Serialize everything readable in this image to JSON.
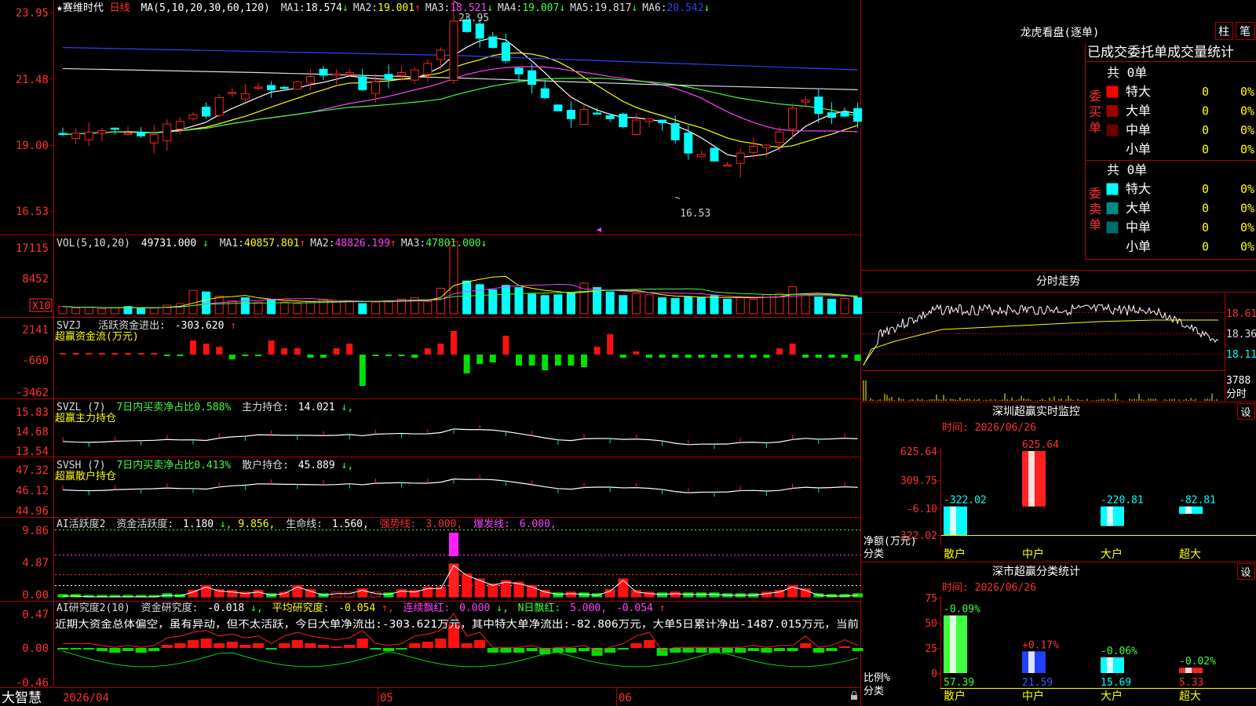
{
  "footer": {
    "app_name": "大智慧",
    "dates": [
      "2026/04",
      "05",
      "06"
    ]
  },
  "main": {
    "stock_name": "★赛维时代",
    "period": "日线",
    "ma_title": "MA(5,10,20,30,60,120)",
    "ma_values": [
      {
        "label": "MA1:",
        "value": "18.574",
        "arrow": "↓",
        "color": "#ffffff"
      },
      {
        "label": "MA2:",
        "value": "19.001",
        "arrow": "↑",
        "color": "#ffff00"
      },
      {
        "label": "MA3:",
        "value": "18.521",
        "arrow": "↓",
        "color": "#ff40ff"
      },
      {
        "label": "MA4:",
        "value": "19.007",
        "arrow": "↓",
        "color": "#40ff40"
      },
      {
        "label": "MA5:",
        "value": "19.817",
        "arrow": "↓",
        "color": "#dddddd"
      },
      {
        "label": "MA6:",
        "value": "20.542",
        "arrow": "↓",
        "color": "#3040ff"
      }
    ],
    "y_ticks": [
      "23.95",
      "21.48",
      "19.00",
      "16.53"
    ],
    "max_label": "23.95",
    "min_label": "16.53",
    "scale_min": 15.2,
    "scale_max": 24.0
  },
  "vol": {
    "title": "VOL(5,10,20)",
    "value": "49731.000",
    "value_arrow": "↓",
    "ma": [
      {
        "label": "MA1:",
        "value": "40857.801",
        "arrow": "↑",
        "color": "#ffff00"
      },
      {
        "label": "MA2:",
        "value": "48826.199",
        "arrow": "↑",
        "color": "#ff40ff"
      },
      {
        "label": "MA3:",
        "value": "47801.000",
        "arrow": "↓",
        "color": "#40ff40"
      }
    ],
    "y_ticks": [
      "17115",
      "8452"
    ],
    "unit": "X10"
  },
  "svzj": {
    "title": "SVZJ",
    "label": "活跃资金进出:",
    "value": "-303.620",
    "arrow": "↑",
    "subtitle": "超赢资金流(万元)",
    "y_ticks": [
      "2141",
      "-660",
      "-3462"
    ]
  },
  "svzl": {
    "title": "SVZL  (7)",
    "label": "7日内买卖净占比0.588%",
    "hold_label": "主力持仓:",
    "hold_value": "14.021",
    "arrow": "↓,",
    "subtitle": "超赢主力持仓",
    "y_ticks": [
      "15.83",
      "14.68",
      "13.54"
    ]
  },
  "svsh": {
    "title": "SVSH  (7)",
    "label": "7日内买卖净占比0.413%",
    "hold_label": "散户持仓:",
    "hold_value": "45.889",
    "arrow": "↓,",
    "subtitle": "超赢散户持仓",
    "y_ticks": [
      "47.32",
      "46.12",
      "44.96"
    ]
  },
  "ai1": {
    "title": "AI活跃度2",
    "label": "资金活跃度:",
    "value": "1.180",
    "arrow": "↓,",
    "value2": "9.856,",
    "life_label": "生命线:",
    "life_value": "1.560,",
    "strong_label": "强势线:",
    "strong_value": "3.000,",
    "burst_label": "爆发线:",
    "burst_value": "6.000,",
    "y_ticks": [
      "9.86",
      "4.87",
      "0.00"
    ]
  },
  "ai2": {
    "title": "AI研究度2(10)",
    "label": "资金研究度:",
    "value": "-0.018",
    "arrow": "↓,",
    "avg_label": "平均研究度:",
    "avg_value": "-0.054",
    "avg_arrow": "↑,",
    "red_label": "连续飘红:",
    "red_value": "0.000",
    "red_arrow": "↓,",
    "n_label": "N日飘红:",
    "n_value": "5.000,",
    "n_value2": "-0.054",
    "n_arrow": "↑",
    "comment": "近期大资金总体偏空，虽有异动，但不太活跃，今日大单净流出:-303.621万元，其中特大单净流出:-82.806万元，大单5日累计净出-1487.015万元，当前",
    "y_ticks": [
      "0.47",
      "0.00",
      "-0.46"
    ]
  },
  "lhb": {
    "title": "龙虎看盘(逐单)",
    "tab1": "柱",
    "tab2": "笔",
    "header": "已成交委托单成交量统计",
    "buy_side": "委买单",
    "sell_side": "委卖单",
    "buy_total": "共 0单",
    "sell_total": "共 0单",
    "buy_rows": [
      {
        "name": "特大",
        "count": "0",
        "pct": "0%",
        "color": "#ff0000"
      },
      {
        "name": "大单",
        "count": "0",
        "pct": "0%",
        "color": "#9a0000"
      },
      {
        "name": "中单",
        "count": "0",
        "pct": "0%",
        "color": "#6a0000"
      },
      {
        "name": "小单",
        "count": "0",
        "pct": "0%",
        "color": "#000000"
      }
    ],
    "sell_rows": [
      {
        "name": "特大",
        "count": "0",
        "pct": "0%",
        "color": "#00ffff"
      },
      {
        "name": "大单",
        "count": "0",
        "pct": "0%",
        "color": "#008a8a"
      },
      {
        "name": "中单",
        "count": "0",
        "pct": "0%",
        "color": "#006a6a"
      },
      {
        "name": "小单",
        "count": "0",
        "pct": "0%",
        "color": "#000000"
      }
    ]
  },
  "fenshi": {
    "title": "分时走势",
    "y_labels": [
      "18.61",
      "18.36",
      "18.11"
    ],
    "vol_label": "3788",
    "unit": "分时"
  },
  "monitor": {
    "title": "深圳超赢实时监控",
    "set_button": "设",
    "time_label": "时间: 2026/06/26",
    "y_ticks": [
      "625.64",
      "309.75",
      "-6.10",
      "-322.02"
    ],
    "unit": "净额(万元)",
    "category_label": "分类",
    "chart_data": {
      "type": "bar",
      "categories": [
        "散户",
        "中户",
        "大户",
        "超大"
      ],
      "values": [
        -322.02,
        625.64,
        -220.81,
        -82.81
      ],
      "value_labels": [
        "-322.02",
        "625.64",
        "-220.81",
        "-82.81"
      ],
      "ylim": [
        -322.02,
        625.64
      ]
    }
  },
  "classify": {
    "title": "深市超赢分类统计",
    "set_button": "设",
    "time_label": "时间: 2026/06/26",
    "y_ticks": [
      "75",
      "50",
      "25",
      "0"
    ],
    "unit": "比例%",
    "category_label": "分类",
    "chart_data": {
      "type": "bar",
      "categories": [
        "散户",
        "中户",
        "大户",
        "超大"
      ],
      "values": [
        57.39,
        21.59,
        15.69,
        5.33
      ],
      "value_labels": [
        "57.39",
        "21.59",
        "15.69",
        "5.33"
      ],
      "change_labels": [
        "-0.09%",
        "+0.17%",
        "-0.06%",
        "-0.02%"
      ],
      "ylim": [
        0,
        75
      ]
    }
  }
}
